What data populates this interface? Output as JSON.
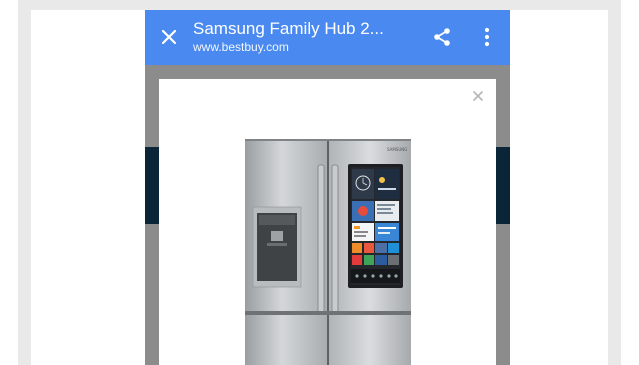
{
  "toolbar": {
    "title": "Samsung Family Hub 2...",
    "url": "www.bestbuy.com",
    "close_icon": "close-icon",
    "share_icon": "share-icon",
    "more_icon": "more-vert-icon"
  },
  "modal": {
    "close_icon": "close-icon",
    "product_image": "refrigerator-image",
    "brand_text": "SAMSUNG"
  },
  "colors": {
    "toolbar_bg": "#4a8af0",
    "overlay": "#8c8c8c",
    "band": "#0a2438"
  }
}
